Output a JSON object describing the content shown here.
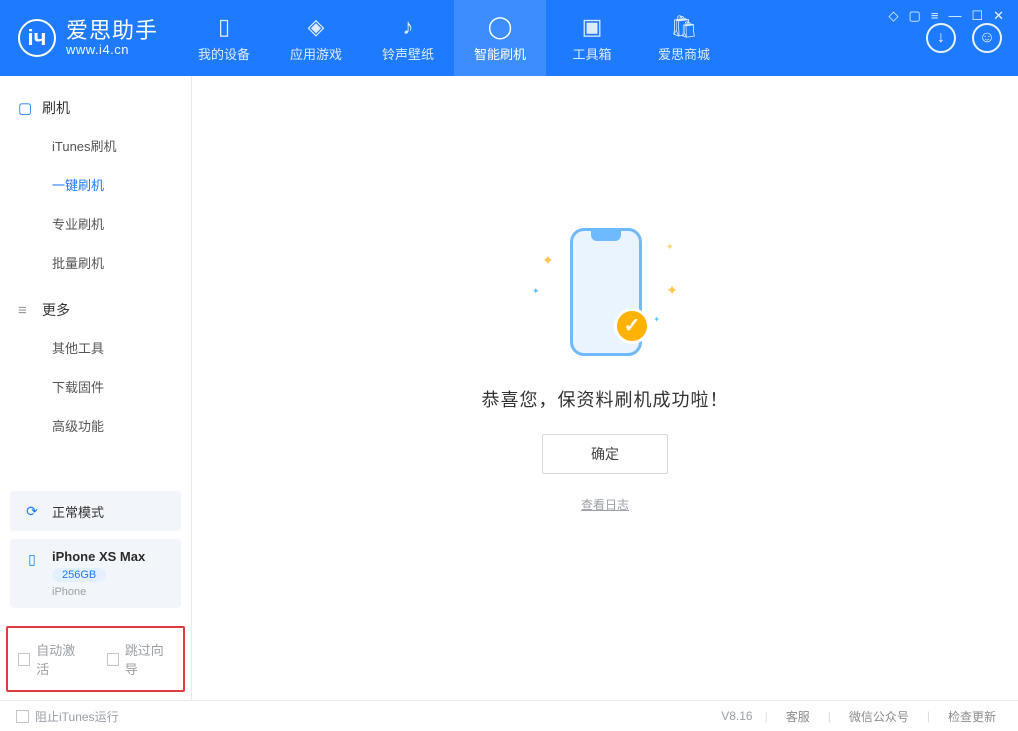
{
  "app": {
    "name": "爱思助手",
    "url": "www.i4.cn"
  },
  "tabs": [
    {
      "label": "我的设备"
    },
    {
      "label": "应用游戏"
    },
    {
      "label": "铃声壁纸"
    },
    {
      "label": "智能刷机"
    },
    {
      "label": "工具箱"
    },
    {
      "label": "爱思商城"
    }
  ],
  "sidebar": {
    "group1_title": "刷机",
    "group1_items": [
      "iTunes刷机",
      "一键刷机",
      "专业刷机",
      "批量刷机"
    ],
    "group2_title": "更多",
    "group2_items": [
      "其他工具",
      "下载固件",
      "高级功能"
    ]
  },
  "device": {
    "mode": "正常模式",
    "name": "iPhone XS Max",
    "storage": "256GB",
    "type": "iPhone"
  },
  "options": {
    "auto_activate": "自动激活",
    "skip_guide": "跳过向导"
  },
  "main": {
    "success_text": "恭喜您，保资料刷机成功啦！",
    "ok": "确定",
    "view_log": "查看日志"
  },
  "status": {
    "block_itunes": "阻止iTunes运行",
    "version": "V8.16",
    "links": [
      "客服",
      "微信公众号",
      "检查更新"
    ]
  }
}
